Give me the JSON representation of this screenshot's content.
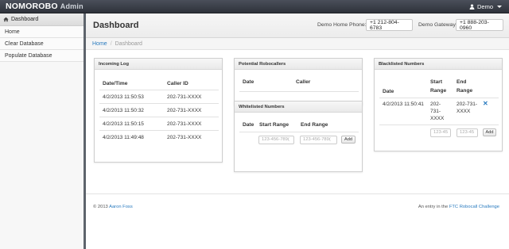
{
  "topbar": {
    "brand": "NOMOROBO",
    "brand_suffix": "Admin",
    "user_label": "Demo"
  },
  "sidebar": {
    "header_label": "Dashboard",
    "items": [
      {
        "label": "Home"
      },
      {
        "label": "Clear Database"
      },
      {
        "label": "Populate Database"
      }
    ]
  },
  "header": {
    "title": "Dashboard",
    "home_phone_label": "Demo Home Phone:",
    "home_phone_value": "+1 212-804-6783",
    "gateway_label": "Demo Gateway:",
    "gateway_value": "+1 888-203-0960"
  },
  "breadcrumb": {
    "home": "Home",
    "separator": "/",
    "current": "Dashboard"
  },
  "incoming_log": {
    "title": "Incoming Log",
    "columns": [
      "Date/Time",
      "Caller ID"
    ],
    "rows": [
      [
        "4/2/2013 11:50:53",
        "202-731-XXXX"
      ],
      [
        "4/2/2013 11:50:32",
        "202-731-XXXX"
      ],
      [
        "4/2/2013 11:50:15",
        "202-731-XXXX"
      ],
      [
        "4/2/2013 11:49:48",
        "202-731-XXXX"
      ]
    ]
  },
  "potential_robocallers": {
    "title": "Potential Robocallers",
    "columns": [
      "Date",
      "Caller"
    ]
  },
  "whitelisted": {
    "title": "Whitelisted Numbers",
    "columns": [
      "Date",
      "Start Range",
      "End Range"
    ],
    "start_placeholder": "123-456-789(",
    "end_placeholder": "123-456-789(",
    "add_label": "Add"
  },
  "blacklisted": {
    "title": "Blacklisted Numbers",
    "columns": [
      "Date",
      "Start",
      "Range",
      "End",
      "Range"
    ],
    "row": {
      "date": "4/2/2013 11:50:41",
      "start_lines": [
        "202-",
        "731-",
        "XXXX"
      ],
      "end_lines": [
        "202-731-",
        "XXXX"
      ]
    },
    "start_placeholder": "123-45",
    "end_placeholder": "123-45",
    "add_label": "Add"
  },
  "footer": {
    "copyright": "© 2013",
    "author": "Aaron Foss",
    "entry_prefix": "An entry in the",
    "challenge": "FTC Robocall Challenge"
  },
  "colors": {
    "topbar": "#3a3e47",
    "link": "#2a7bbf",
    "sidebar_border": "#5e646c"
  }
}
